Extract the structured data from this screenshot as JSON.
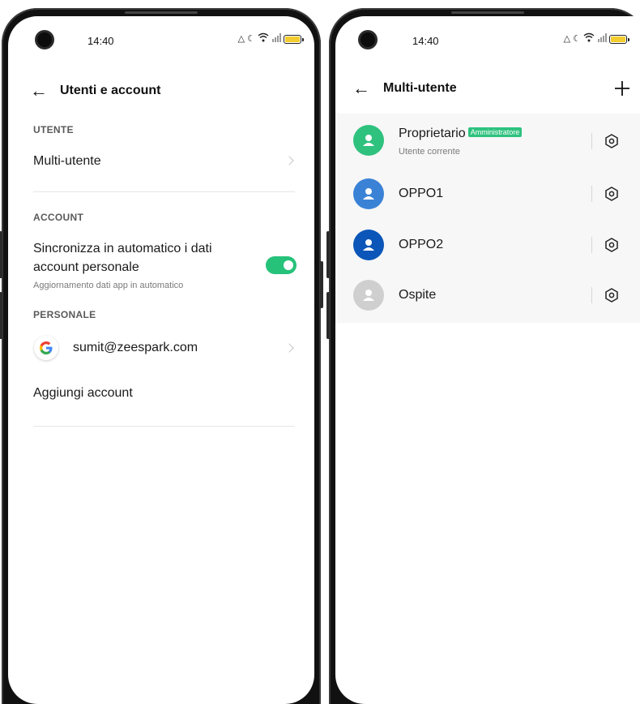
{
  "left_screen": {
    "status": {
      "time": "14:40"
    },
    "header": {
      "title": "Utenti e account"
    },
    "sections": {
      "utente": "UTENTE",
      "account": "ACCOUNT",
      "personale": "PERSONALE"
    },
    "items": {
      "multi_utente": "Multi-utente",
      "sync_line1": "Sincronizza in automatico i dati",
      "sync_line2": "account personale",
      "sync_subtitle": "Aggiornamento dati app in automatico",
      "sync_enabled": true,
      "google_account": "sumit@zeespark.com",
      "add_account": "Aggiungi account"
    }
  },
  "right_screen": {
    "status": {
      "time": "14:40"
    },
    "header": {
      "title": "Multi-utente"
    },
    "users": [
      {
        "name": "Proprietario",
        "badge": "Amministratore",
        "subtitle": "Utente corrente",
        "avatar_color": "#2ec27e"
      },
      {
        "name": "OPPO1",
        "avatar_color": "#3a82d6"
      },
      {
        "name": "OPPO2",
        "avatar_color": "#0b56b8"
      },
      {
        "name": "Ospite",
        "avatar_color": "#cfcfcf"
      }
    ]
  },
  "colors": {
    "accent_green": "#26c27a",
    "badge_green": "#2ec27e",
    "battery": "#f3cc2f"
  }
}
